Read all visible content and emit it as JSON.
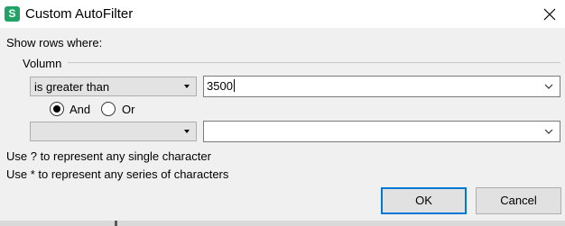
{
  "window": {
    "title": "Custom AutoFilter",
    "app_icon_letter": "S",
    "app_icon_color": "#21a366"
  },
  "dialog": {
    "show_rows_label": "Show rows where:",
    "group_label": "Volumn",
    "condition1": {
      "operator": "is greater than",
      "value": "3500"
    },
    "logic": {
      "and_label": "And",
      "or_label": "Or",
      "selected": "And"
    },
    "condition2": {
      "operator": "",
      "value": ""
    },
    "hint1": "Use ? to represent any single character",
    "hint2": "Use * to represent any series of characters",
    "ok_label": "OK",
    "cancel_label": "Cancel",
    "accent_color": "#0078d7"
  },
  "icons": {
    "close": "close-icon",
    "dropdown": "chevron-down-icon"
  }
}
